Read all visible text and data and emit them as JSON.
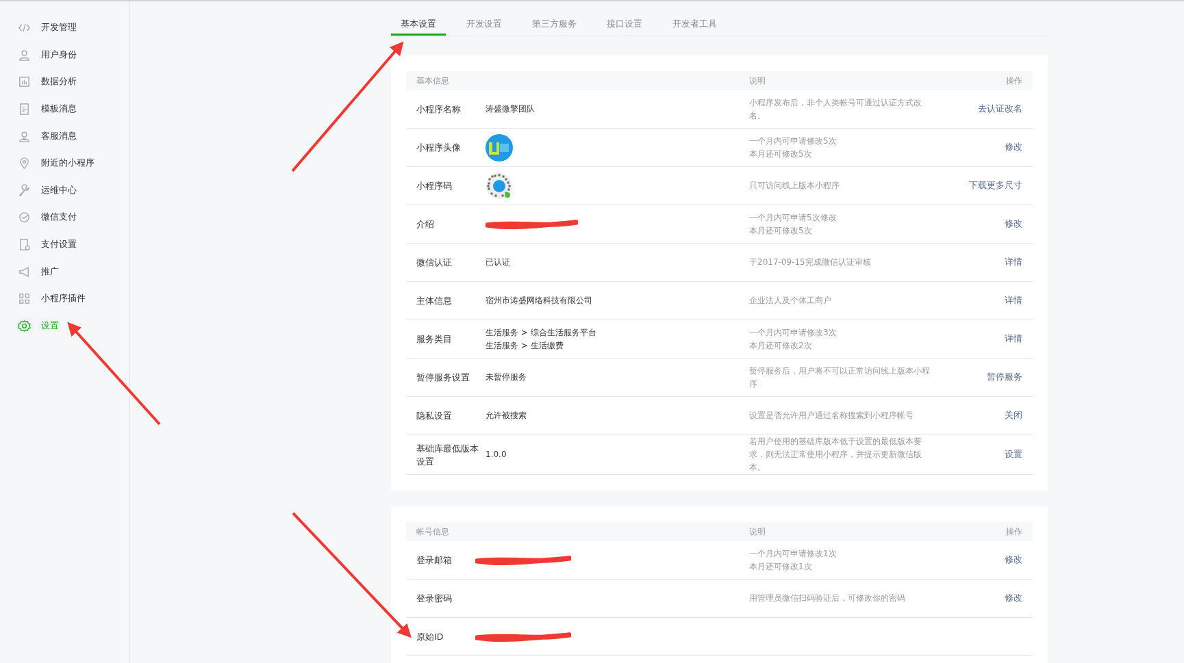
{
  "sidebar": {
    "items": [
      {
        "label": "开发管理",
        "selected": false
      },
      {
        "label": "用户身份",
        "selected": false
      },
      {
        "label": "数据分析",
        "selected": false
      },
      {
        "label": "模板消息",
        "selected": false
      },
      {
        "label": "客服消息",
        "selected": false
      },
      {
        "label": "附近的小程序",
        "selected": false
      },
      {
        "label": "运维中心",
        "selected": false
      },
      {
        "label": "微信支付",
        "selected": false
      },
      {
        "label": "支付设置",
        "selected": false
      },
      {
        "label": "推广",
        "selected": false
      },
      {
        "label": "小程序插件",
        "selected": false
      },
      {
        "label": "设置",
        "selected": true
      }
    ]
  },
  "tabs": [
    {
      "label": "基本设置",
      "selected": true
    },
    {
      "label": "开发设置",
      "selected": false
    },
    {
      "label": "第三方服务",
      "selected": false
    },
    {
      "label": "接口设置",
      "selected": false
    },
    {
      "label": "开发者工具",
      "selected": false
    }
  ],
  "sections": [
    {
      "columns": [
        "基本信息",
        "说明",
        "操作"
      ],
      "rows": [
        {
          "label": "小程序名称",
          "kind": "text",
          "value": [
            "涛盛微擎团队"
          ],
          "description": [
            "小程序发布后，非个人类帐号可通过认证方式改名。"
          ],
          "action": "去认证改名"
        },
        {
          "label": "小程序头像",
          "kind": "avatar",
          "description": [
            "一个月内可申请修改5次",
            "本月还可修改5次"
          ],
          "action": "修改"
        },
        {
          "label": "小程序码",
          "kind": "qr",
          "description": [
            "只可访问线上版本小程序"
          ],
          "action": "下载更多尺寸"
        },
        {
          "label": "介绍",
          "kind": "redacted",
          "description": [
            "一个月内可申请5次修改",
            "本月还可修改5次"
          ],
          "action": "修改"
        },
        {
          "label": "微信认证",
          "kind": "text",
          "value": [
            "已认证"
          ],
          "description": [
            "于2017-09-15完成微信认证审核"
          ],
          "action": "详情"
        },
        {
          "label": "主体信息",
          "kind": "text",
          "value": [
            "宿州市涛盛网络科技有限公司"
          ],
          "description": [
            "企业法人及个体工商户"
          ],
          "action": "详情"
        },
        {
          "label": "服务类目",
          "kind": "text",
          "value": [
            "生活服务 > 综合生活服务平台",
            "生活服务 > 生活缴费"
          ],
          "description": [
            "一个月内可申请修改3次",
            "本月还可修改2次"
          ],
          "action": "详情"
        },
        {
          "label": "暂停服务设置",
          "kind": "text",
          "value": [
            "未暂停服务"
          ],
          "description": [
            "暂停服务后，用户将不可以正常访问线上版本小程序"
          ],
          "action": "暂停服务"
        },
        {
          "label": "隐私设置",
          "kind": "text",
          "value": [
            "允许被搜索"
          ],
          "description": [
            "设置是否允许用户通过名称搜索到小程序帐号"
          ],
          "action": "关闭"
        },
        {
          "label": "基础库最低版本设置",
          "kind": "text",
          "value": [
            "1.0.0"
          ],
          "description": [
            "若用户使用的基础库版本低于设置的最低版本要求，则无法正常使用小程序，并提示更新微信版本。"
          ],
          "action": "设置"
        }
      ]
    },
    {
      "columns": [
        "帐号信息",
        "说明",
        "操作"
      ],
      "rows": [
        {
          "label": "登录邮箱",
          "kind": "redacted",
          "description": [
            "一个月内可申请修改1次",
            "本月还可修改1次"
          ],
          "action": "修改"
        },
        {
          "label": "登录密码",
          "kind": "none",
          "description": [
            "用管理员微信扫码验证后，可修改你的密码"
          ],
          "action": "修改"
        },
        {
          "label": "原始ID",
          "kind": "redacted"
        }
      ]
    }
  ]
}
